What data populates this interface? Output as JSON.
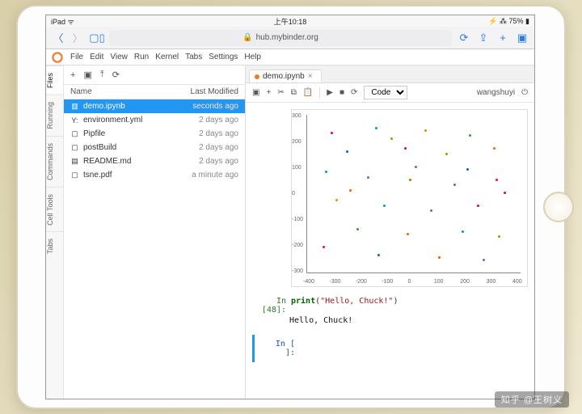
{
  "status": {
    "carrier": "iPad ᯤ",
    "time": "上午10:18",
    "battery": "⚡ ⁂ 75% ▮"
  },
  "safari": {
    "url": "hub.mybinder.org",
    "lock": "🔒"
  },
  "menubar": {
    "items": [
      "File",
      "Edit",
      "View",
      "Run",
      "Kernel",
      "Tabs",
      "Settings",
      "Help"
    ]
  },
  "sidetabs": [
    "Files",
    "Running",
    "Commands",
    "Cell Tools",
    "Tabs"
  ],
  "filebar": {
    "new": "+",
    "folder": "▣",
    "upload": "⤒",
    "refresh": "⟳"
  },
  "listhead": {
    "name": "Name",
    "mod": "Last Modified"
  },
  "files": [
    {
      "icon": "▥",
      "iconName": "notebook-icon",
      "name": "demo.ipynb",
      "mod": "seconds ago",
      "sel": true
    },
    {
      "icon": "Y:",
      "iconName": "yaml-icon",
      "name": "environment.yml",
      "mod": "2 days ago"
    },
    {
      "icon": "▢",
      "iconName": "file-icon",
      "name": "Pipfile",
      "mod": "2 days ago"
    },
    {
      "icon": "▢",
      "iconName": "file-icon",
      "name": "postBuild",
      "mod": "2 days ago"
    },
    {
      "icon": "▤",
      "iconName": "markdown-icon",
      "name": "README.md",
      "mod": "2 days ago"
    },
    {
      "icon": "▢",
      "iconName": "file-icon",
      "name": "tsne.pdf",
      "mod": "a minute ago"
    }
  ],
  "tab": {
    "label": "demo.ipynb",
    "close": "×"
  },
  "toolbar": {
    "save": "▣",
    "add": "+",
    "cut": "✂",
    "copy": "⧉",
    "paste": "📋",
    "run": "▶",
    "stop": "■",
    "restart": "⟳",
    "celltype": "Code",
    "user": "wangshuyi",
    "power": "⏻"
  },
  "cells": {
    "in48": {
      "prompt": "In [48]:",
      "kw": "print",
      "paren_open": "(",
      "str": "\"Hello, Chuck!\"",
      "paren_close": ")"
    },
    "out48": "Hello, Chuck!",
    "empty": {
      "prompt": "In [ ]:"
    }
  },
  "chart_data": {
    "type": "scatter",
    "xlabel": "",
    "ylabel": "",
    "xlim": [
      -400,
      400
    ],
    "ylim": [
      -300,
      300
    ],
    "xticks": [
      -400,
      -300,
      -200,
      -100,
      0,
      100,
      200,
      300,
      400
    ],
    "yticks": [
      -300,
      -200,
      -100,
      0,
      100,
      200,
      300
    ],
    "series": [
      {
        "x": -320,
        "y": 240,
        "c": "#e06"
      },
      {
        "x": -150,
        "y": 260,
        "c": "#09c"
      },
      {
        "x": 40,
        "y": 250,
        "c": "#c90"
      },
      {
        "x": 210,
        "y": 230,
        "c": "#393"
      },
      {
        "x": -260,
        "y": 170,
        "c": "#06c"
      },
      {
        "x": -40,
        "y": 180,
        "c": "#c06"
      },
      {
        "x": 120,
        "y": 160,
        "c": "#990"
      },
      {
        "x": 300,
        "y": 180,
        "c": "#e60"
      },
      {
        "x": -340,
        "y": 90,
        "c": "#09c"
      },
      {
        "x": -180,
        "y": 70,
        "c": "#66c"
      },
      {
        "x": -20,
        "y": 60,
        "c": "#c60"
      },
      {
        "x": 150,
        "y": 40,
        "c": "#393"
      },
      {
        "x": 310,
        "y": 60,
        "c": "#e06"
      },
      {
        "x": -300,
        "y": -20,
        "c": "#c90"
      },
      {
        "x": -120,
        "y": -40,
        "c": "#09c"
      },
      {
        "x": 60,
        "y": -60,
        "c": "#66c"
      },
      {
        "x": 240,
        "y": -40,
        "c": "#c06"
      },
      {
        "x": -220,
        "y": -130,
        "c": "#393"
      },
      {
        "x": -30,
        "y": -150,
        "c": "#e60"
      },
      {
        "x": 180,
        "y": -140,
        "c": "#09c"
      },
      {
        "x": 320,
        "y": -160,
        "c": "#990"
      },
      {
        "x": -140,
        "y": -230,
        "c": "#06c"
      },
      {
        "x": 90,
        "y": -240,
        "c": "#c60"
      },
      {
        "x": 260,
        "y": -250,
        "c": "#66c"
      },
      {
        "x": -350,
        "y": -200,
        "c": "#e06"
      },
      {
        "x": 0,
        "y": 110,
        "c": "#393"
      },
      {
        "x": 200,
        "y": 100,
        "c": "#06c"
      },
      {
        "x": -90,
        "y": 220,
        "c": "#990"
      },
      {
        "x": 340,
        "y": 10,
        "c": "#c06"
      },
      {
        "x": -250,
        "y": 20,
        "c": "#e60"
      }
    ]
  },
  "watermark": "知乎 @王树义"
}
